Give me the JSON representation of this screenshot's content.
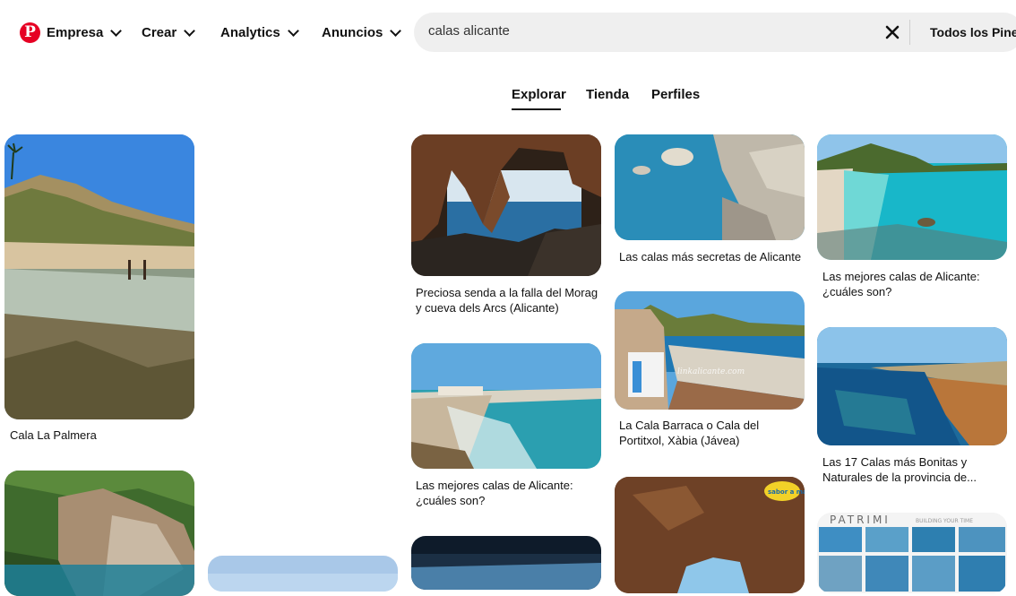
{
  "nav": {
    "logo_glyph": "P",
    "empresa": "Empresa",
    "crear": "Crear",
    "analytics": "Analytics",
    "anuncios": "Anuncios"
  },
  "search": {
    "value": "calas alicante",
    "filter_label": "Todos los Pines"
  },
  "tabs": [
    "Explorar",
    "Tienda",
    "Perfiles"
  ],
  "active_tab": "Explorar",
  "pins": [
    {
      "title": "Cala La Palmera"
    },
    {
      "title": "Preciosa senda a la falla del Morag y cueva dels Arcs (Alicante)"
    },
    {
      "title": "Las calas más secretas de Alicante"
    },
    {
      "title": "Las mejores calas de Alicante: ¿cuáles son?"
    },
    {
      "title": "La Cala Barraca o Cala del Portitxol, Xàbia (Jávea)"
    },
    {
      "title": "Las 17 Calas más Bonitas y Naturales de la provincia de..."
    },
    {
      "title": "Las mejores calas de Alicante: ¿cuáles son?"
    }
  ],
  "image_overlays": {
    "watermark": "linkalicante.com",
    "patrimi": "PATRIMI",
    "patrimi_tagline": "BUILDING YOUR TIME",
    "sticker": "sabor a mar"
  },
  "colors": {
    "brand": "#e60023",
    "search_bg": "#efefef",
    "text": "#111111"
  }
}
